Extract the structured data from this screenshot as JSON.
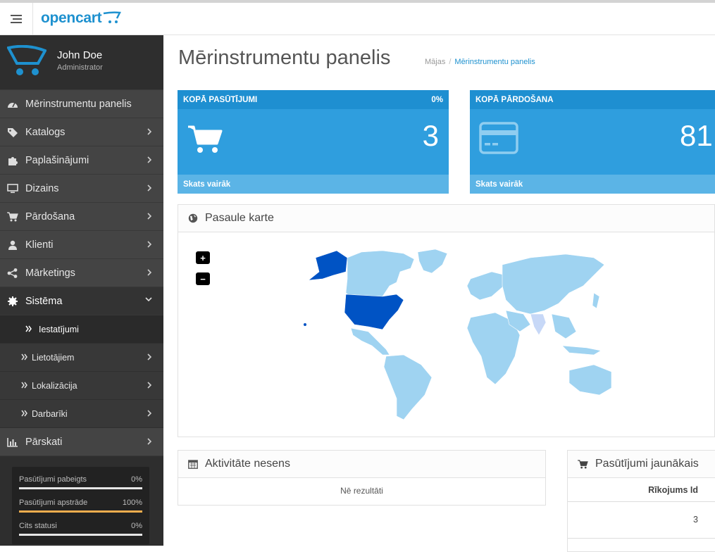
{
  "header": {
    "logo_text": "opencart",
    "menu_icon": "hamburger-icon"
  },
  "profile": {
    "name": "John Doe",
    "role": "Administrator"
  },
  "sidebar": {
    "items": [
      {
        "label": "Mērinstrumentu panelis",
        "icon": "dashboard-icon",
        "has_children": false
      },
      {
        "label": "Katalogs",
        "icon": "tags-icon",
        "has_children": true
      },
      {
        "label": "Paplašinājumi",
        "icon": "puzzle-icon",
        "has_children": true
      },
      {
        "label": "Dizains",
        "icon": "desktop-icon",
        "has_children": true
      },
      {
        "label": "Pārdošana",
        "icon": "cart-icon",
        "has_children": true
      },
      {
        "label": "Klienti",
        "icon": "user-icon",
        "has_children": true
      },
      {
        "label": "Mārketings",
        "icon": "share-icon",
        "has_children": true
      },
      {
        "label": "Sistēma",
        "icon": "gear-icon",
        "expanded": true
      }
    ],
    "sub_items": [
      {
        "label": "Iestatījumi",
        "active": true
      },
      {
        "label": "Lietotājiem",
        "has_children": true
      },
      {
        "label": "Lokalizācija",
        "has_children": true
      },
      {
        "label": "Darbarīki",
        "has_children": true
      }
    ],
    "reports": {
      "label": "Pārskati",
      "icon": "bar-chart-icon"
    }
  },
  "order_status": [
    {
      "name": "Pasūtījumi pabeigts",
      "value": "0%",
      "percent": 0,
      "color": "#5cb85c"
    },
    {
      "name": "Pasūtījumi apstrāde",
      "value": "100%",
      "percent": 100,
      "color": "#f0ad4e"
    },
    {
      "name": "Cits statusi",
      "value": "0%",
      "percent": 0,
      "color": "#d9534f"
    }
  ],
  "page": {
    "title": "Mērinstrumentu panelis",
    "breadcrumb": [
      "Mājas",
      "Mērinstrumentu panelis"
    ]
  },
  "tiles": [
    {
      "title": "KOPĀ PASŪTĪJUMI",
      "badge": "0%",
      "value": "3",
      "footer": "Skats vairāk",
      "icon": "cart-icon"
    },
    {
      "title": "KOPĀ PĀRDOŠANA",
      "badge": "",
      "value": "81",
      "footer": "Skats vairāk",
      "icon": "credit-card-icon"
    }
  ],
  "map_panel": {
    "title": "Pasaule karte",
    "zoom_in": "+",
    "zoom_out": "−",
    "highlight_color": "#0053c4",
    "base_color": "#9fd3f1"
  },
  "activity": {
    "title": "Aktivitāte nesens",
    "empty": "Nē rezultāti"
  },
  "latest_orders": {
    "title": "Pasūtījumi jaunākais",
    "column": "Rīkojums Id",
    "rows": [
      "3"
    ]
  },
  "colors": {
    "accent": "#1e91cf",
    "tile": "#2f9ede",
    "sidebar": "#444444"
  }
}
